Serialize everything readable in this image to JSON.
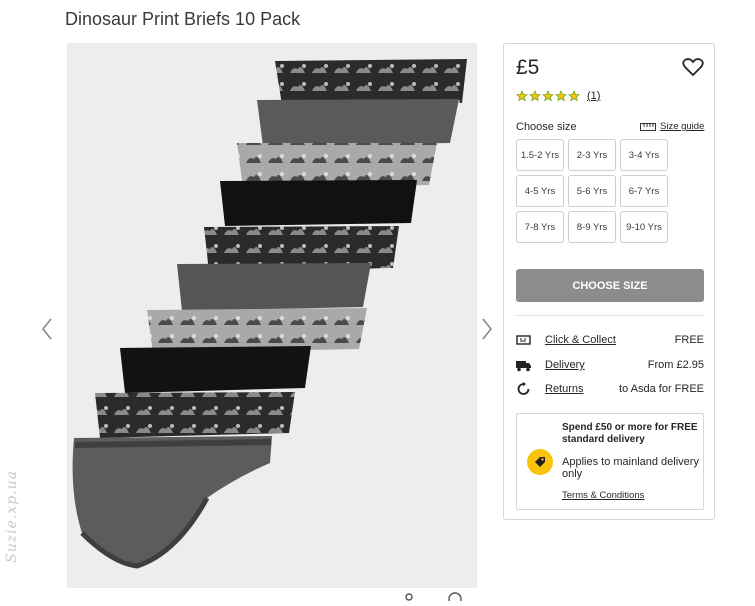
{
  "product": {
    "title": "Dinosaur Print Briefs 10 Pack",
    "price": "£5",
    "rating": 5,
    "review_count": "(1)"
  },
  "gallery": {
    "image_icon": "underwear-stack-image",
    "prev_icon": "chevron-left-icon",
    "next_icon": "chevron-right-icon"
  },
  "size_selector": {
    "label": "Choose size",
    "guide_label": "Size guide",
    "sizes": [
      "1.5-2 Yrs",
      "2-3 Yrs",
      "3-4 Yrs",
      "4-5 Yrs",
      "5-6 Yrs",
      "6-7 Yrs",
      "7-8 Yrs",
      "8-9 Yrs",
      "9-10 Yrs"
    ],
    "button_label": "CHOOSE SIZE"
  },
  "delivery_options": [
    {
      "icon": "click-collect-icon",
      "label": "Click & Collect",
      "value": "FREE"
    },
    {
      "icon": "truck-icon",
      "label": "Delivery",
      "value": "From £2.95"
    },
    {
      "icon": "returns-icon",
      "label": "Returns",
      "value": "to Asda for FREE"
    }
  ],
  "promo": {
    "headline": "Spend £50 or more for FREE standard delivery",
    "body": "Applies to mainland delivery only",
    "terms_label": "Terms & Conditions",
    "icon": "tag-icon"
  },
  "watermark": "Suzie.xp.ua",
  "colors": {
    "accent_yellow": "#f9c40a",
    "star_green": "#68a51c",
    "button_grey": "#8c8c8c"
  }
}
